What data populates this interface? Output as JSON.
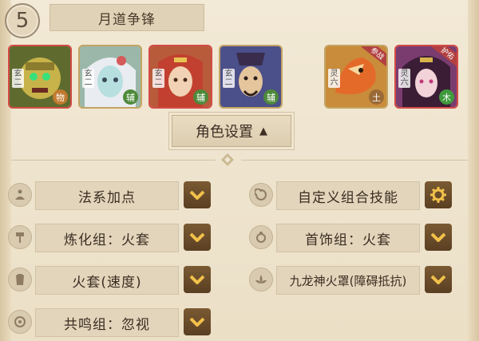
{
  "header": {
    "number": "5",
    "title": "月道争锋"
  },
  "characters": [
    {
      "label": "玄二",
      "role": "物",
      "role_color": "#c27a2e"
    },
    {
      "label": "玄二",
      "role": "辅",
      "role_color": "#4d8a3a"
    },
    {
      "label": "玄二",
      "role": "辅",
      "role_color": "#4d8a3a"
    },
    {
      "label": "玄二",
      "role": "辅",
      "role_color": "#4d8a3a"
    },
    {
      "label": "灵六",
      "role": "土",
      "role_color": "#9a6a36",
      "corner": "参战"
    },
    {
      "label": "灵六",
      "role": "木",
      "role_color": "#3f9a3c",
      "corner": "护佑"
    }
  ],
  "settings_button": {
    "label": "角色设置",
    "arrow": "▲"
  },
  "left_rows": [
    {
      "icon": "meditate-icon",
      "label": "法系加点"
    },
    {
      "icon": "hammer-icon",
      "label": "炼化组：火套"
    },
    {
      "icon": "armor-icon",
      "label": "火套(速度)"
    },
    {
      "icon": "resonance-icon",
      "label": "共鸣组：忽视"
    }
  ],
  "right_rows": [
    {
      "icon": "swirl-icon",
      "label": "自定义组合技能"
    },
    {
      "icon": "jewelry-icon",
      "label": "首饰组：火套"
    },
    {
      "icon": "lotus-icon",
      "label": "九龙神火罩(障碍抵抗)"
    }
  ],
  "colors": {
    "background": "#efe5d0",
    "dropdown": "#6a4a29",
    "chevron": "#f2c14a"
  }
}
